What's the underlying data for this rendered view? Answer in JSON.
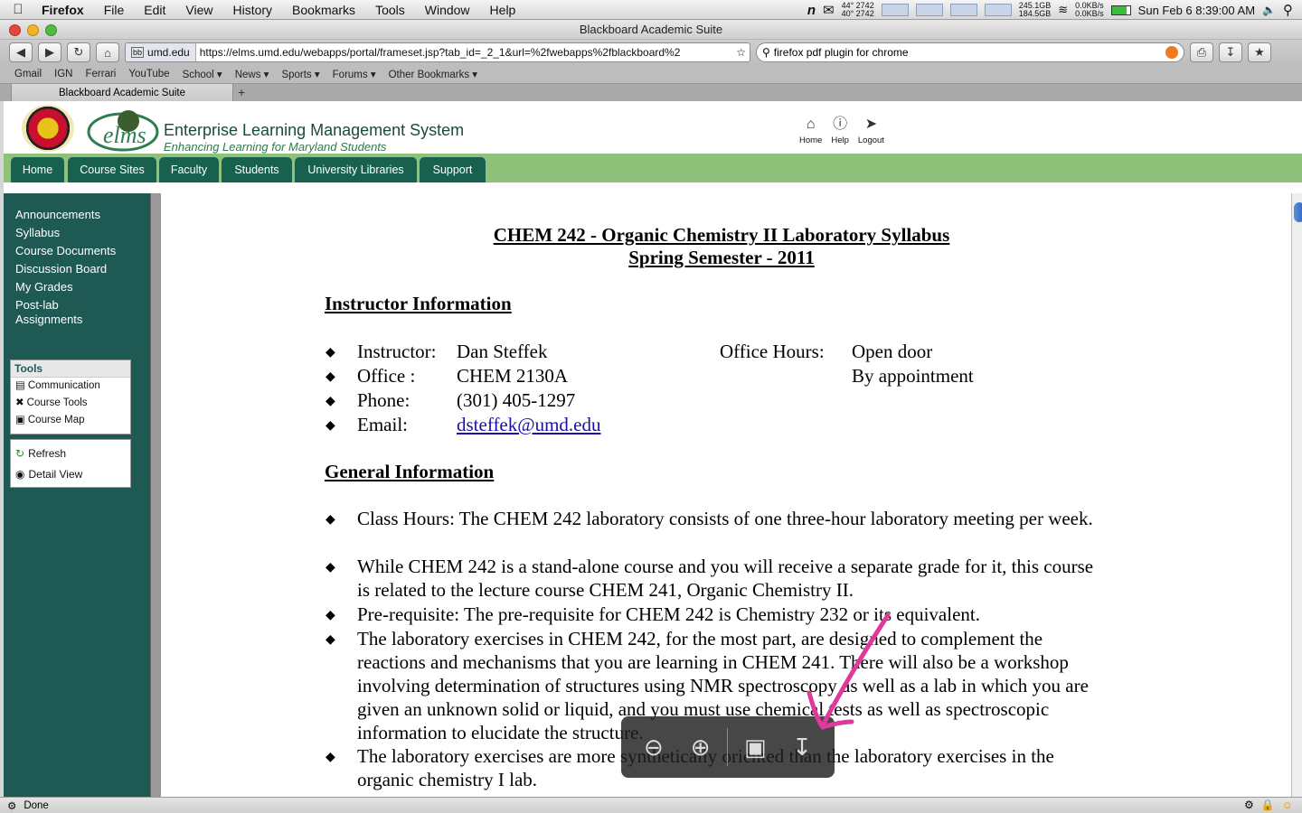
{
  "menubar": {
    "app": "Firefox",
    "items": [
      "File",
      "Edit",
      "View",
      "History",
      "Bookmarks",
      "Tools",
      "Window",
      "Help"
    ],
    "temp1": "44° 2742",
    "temp2": "40° 2742",
    "disk1": "245.1GB",
    "disk2": "184.5GB",
    "net1": "0.0KB/s",
    "net2": "0.0KB/s",
    "clock": "Sun Feb 6   8:39:00 AM"
  },
  "window": {
    "title": "Blackboard Academic Suite"
  },
  "toolbar": {
    "site": "umd.edu",
    "url": "https://elms.umd.edu/webapps/portal/frameset.jsp?tab_id=_2_1&url=%2fwebapps%2fblackboard%2",
    "search": "firefox pdf plugin for chrome"
  },
  "bookmarks": [
    "Gmail",
    "IGN",
    "Ferrari",
    "YouTube",
    "School ▾",
    "News ▾",
    "Sports ▾",
    "Forums ▾",
    "Other Bookmarks ▾"
  ],
  "tab": {
    "label": "Blackboard Academic Suite"
  },
  "header": {
    "system": "Enterprise Learning Management System",
    "tagline": "Enhancing Learning  for  Maryland  Students",
    "links": [
      "Home",
      "Help",
      "Logout"
    ]
  },
  "nav": [
    "Home",
    "Course Sites",
    "Faculty",
    "Students",
    "University Libraries",
    "Support"
  ],
  "sidebar": {
    "links": [
      "Announcements",
      "Syllabus",
      "Course Documents",
      "Discussion Board",
      "My Grades",
      "Post-lab Assignments"
    ],
    "tools_title": "Tools",
    "tools": [
      "Communication",
      "Course Tools",
      "Course Map"
    ],
    "actions": [
      "Refresh",
      "Detail View"
    ]
  },
  "doc": {
    "title1": "CHEM 242 - Organic Chemistry II Laboratory Syllabus",
    "title2": "Spring Semester -  2011",
    "sec1": "Instructor Information",
    "instructor_label": "Instructor:",
    "instructor": "Dan Steffek",
    "office_label": "Office :",
    "office": "CHEM 2130A",
    "phone_label": "Phone:",
    "phone": "(301) 405-1297",
    "email_label": "Email:",
    "email": "dsteffek@umd.edu",
    "hours_label": "Office Hours:",
    "hours1": "Open door",
    "hours2": "By appointment",
    "sec2": "General Information",
    "p1": "Class Hours: The CHEM 242 laboratory consists of one three-hour laboratory meeting per week.",
    "p2": "While CHEM 242 is a stand-alone course and you will receive a separate grade for it, this course is related to the lecture course CHEM 241, Organic Chemistry II.",
    "p3": "Pre-requisite: The pre-requisite for CHEM 242 is Chemistry 232 or its equivalent.",
    "p4": "The laboratory exercises in CHEM 242, for the most part, are designed to complement the reactions and mechanisms that you are learning in CHEM 241.  There will also be a workshop involving determination of structures using NMR spectroscopy as well as a lab in which you are given an unknown solid or liquid, and you must use chemical tests as well as spectroscopic information to elucidate the structure.",
    "p5": "The laboratory exercises are more synthetically oriented than the laboratory exercises in the organic chemistry I lab."
  },
  "status": {
    "text": "Done"
  }
}
